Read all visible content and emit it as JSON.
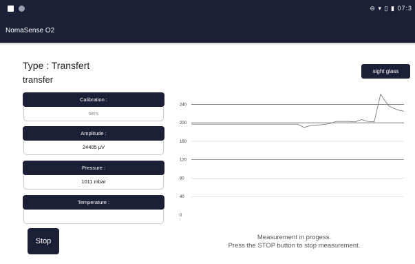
{
  "statusbar": {
    "time": "07:3",
    "icons": [
      "image-icon",
      "circle-icon",
      "do-not-disturb-icon",
      "wifi-icon",
      "no-sim-icon",
      "battery-icon"
    ]
  },
  "app": {
    "title": "NomaSense O2"
  },
  "info": {
    "type_line": "Type : Transfert",
    "type_value": "transfer"
  },
  "sight_button": {
    "label": "sight glass"
  },
  "fields": {
    "calibration": {
      "label": "Calibration :",
      "value": "tiers"
    },
    "amplitude": {
      "label": "Amplitude :",
      "value": "24405 µV"
    },
    "pressure": {
      "label": "Pressure :",
      "value": "1011 mbar"
    },
    "temperature": {
      "label": "Temperature :",
      "value": ""
    }
  },
  "chart_data": {
    "type": "line",
    "ylim": [
      0,
      260
    ],
    "yticks": [
      0,
      40,
      80,
      120,
      160,
      200,
      240
    ],
    "reference_lines": [
      120,
      200,
      240
    ],
    "series": [
      {
        "x": [
          0,
          5,
          10,
          15,
          20,
          25,
          30,
          35,
          40,
          45,
          50,
          53,
          56,
          59,
          62,
          65,
          68,
          71,
          74,
          77,
          80,
          83,
          86,
          89,
          91,
          93,
          95,
          97,
          100
        ],
        "values": [
          197,
          197,
          197,
          197,
          197,
          197,
          197,
          197,
          197,
          197,
          197,
          190,
          194,
          195,
          196,
          198,
          203,
          203,
          203,
          202,
          207,
          203,
          202,
          262,
          248,
          236,
          232,
          228,
          225
        ]
      }
    ],
    "colors": {
      "line": "#7a7a7a",
      "grid": "#5a5a5a",
      "minor_grid": "#d0d0d0"
    }
  },
  "stop_button": {
    "label": "Stop"
  },
  "message": {
    "line1": "Measurement in progess.",
    "line2": "Press the STOP button to stop measurement."
  }
}
